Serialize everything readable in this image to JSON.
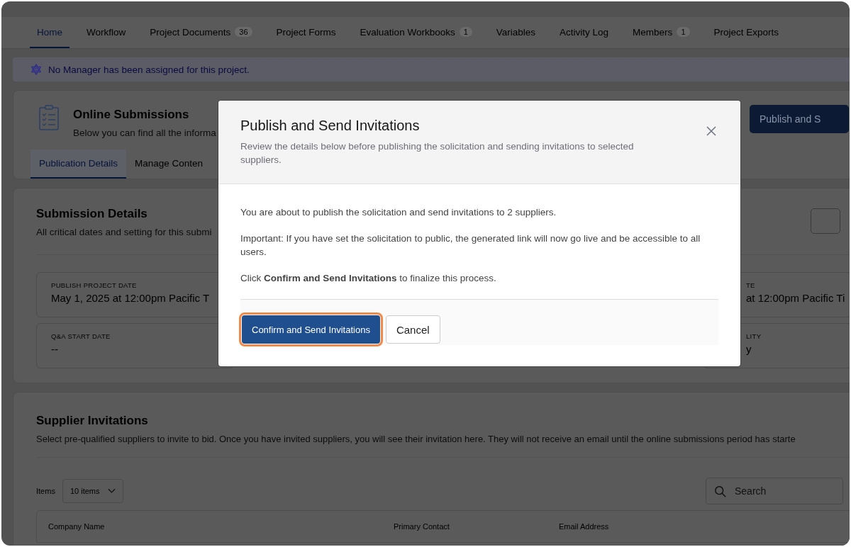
{
  "tabs": [
    {
      "label": "Home",
      "selected": true
    },
    {
      "label": "Workflow",
      "selected": false
    },
    {
      "label": "Project Documents",
      "count": "36",
      "selected": false
    },
    {
      "label": "Project Forms",
      "selected": false
    },
    {
      "label": "Evaluation Workbooks",
      "count": "1",
      "selected": false
    },
    {
      "label": "Variables",
      "selected": false
    },
    {
      "label": "Activity Log",
      "selected": false
    },
    {
      "label": "Members",
      "count": "1",
      "selected": false
    },
    {
      "label": "Project Exports",
      "selected": false
    }
  ],
  "notice": "No Manager has been assigned for this project.",
  "submissions": {
    "title": "Online Submissions",
    "subtitle": "Below you can find all the informa",
    "action": "Publish and S",
    "tabs": [
      {
        "label": "Publication Details",
        "selected": true
      },
      {
        "label": "Manage Conten",
        "selected": false
      }
    ]
  },
  "submission_details": {
    "title": "Submission Details",
    "subtitle": "All critical dates and setting for this submi",
    "fields": [
      {
        "label": "PUBLISH PROJECT DATE",
        "value": "May 1, 2025 at 12:00pm Pacific T"
      },
      {
        "label": "TE",
        "value": "at 12:00pm Pacific Ti"
      },
      {
        "label": "Q&A START DATE",
        "value": "--"
      },
      {
        "label": "LITY",
        "value": "y"
      }
    ]
  },
  "supplier_invitations": {
    "title": "Supplier Invitations",
    "subtitle": "Select pre-qualified suppliers to invite to bid. Once you have invited suppliers, you will see their invitation here. They will not receive an email until the online submissions period has starte",
    "items_label": "Items",
    "items_value": "10 items",
    "search_placeholder": "Search",
    "columns": [
      "Company Name",
      "Primary Contact",
      "Email Address"
    ]
  },
  "dialog": {
    "title": "Publish and Send Invitations",
    "subtitle": "Review the details below before publishing the solicitation and sending invitations to selected suppliers.",
    "paragraphs": [
      "You are about to publish the solicitation and send invitations to 2 suppliers.",
      "Important: If you have set the solicitation to public, the generated link will now go live and be accessible to all users.",
      "Click **Confirm and Send Invitations** to finalize this process."
    ],
    "buttons": [
      {
        "label": "Confirm and Send Invitations",
        "kind": "primary",
        "focused": true
      },
      {
        "label": "Cancel",
        "kind": "secondary",
        "focused": false
      }
    ]
  }
}
